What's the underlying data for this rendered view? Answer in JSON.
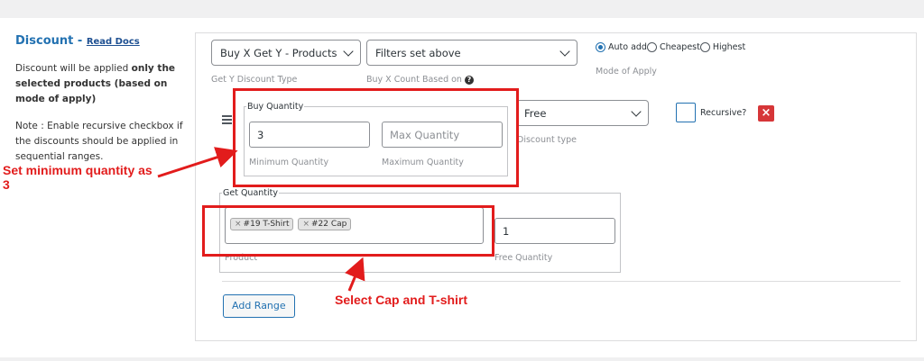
{
  "discount": {
    "title": "Discount",
    "separator": " - ",
    "read_docs": "Read Docs",
    "desc_prefix": "Discount will be applied ",
    "desc_bold": "only the selected products (based on mode of apply)",
    "note": "Note : Enable recursive checkbox if the discounts should be applied in sequential ranges."
  },
  "rule": {
    "discount_type_select": "Buy X Get Y - Products",
    "discount_type_hint": "Get Y Discount Type",
    "count_based_select": "Filters set above",
    "count_based_hint": "Buy X Count Based on",
    "help_icon": "?",
    "mode": {
      "options": [
        "Auto add",
        "Cheapest",
        "Highest"
      ],
      "selected": "Auto add",
      "hint": "Mode of Apply"
    }
  },
  "buy_quantity": {
    "legend": "Buy Quantity",
    "min_value": "3",
    "min_hint": "Minimum Quantity",
    "max_placeholder": "Max Quantity",
    "max_hint": "Maximum Quantity"
  },
  "discount_type": {
    "value": "Free",
    "hint": "Discount type"
  },
  "recursive_label": "Recursive?",
  "close_icon": "×",
  "get_quantity": {
    "legend": "Get Quantity",
    "tags": [
      "#19 T-Shirt",
      "#22 Cap"
    ],
    "tag_remove": "×",
    "product_hint": "Product",
    "free_qty_value": "1",
    "free_qty_hint": "Free Quantity"
  },
  "add_range_label": "Add Range",
  "annotations": {
    "min_qty_text": "Set minimum quantity as 3",
    "select_text": "Select Cap and T-shirt",
    "color": "#e21c1c"
  },
  "colors": {
    "accent": "#2271b1",
    "danger": "#d63638"
  }
}
